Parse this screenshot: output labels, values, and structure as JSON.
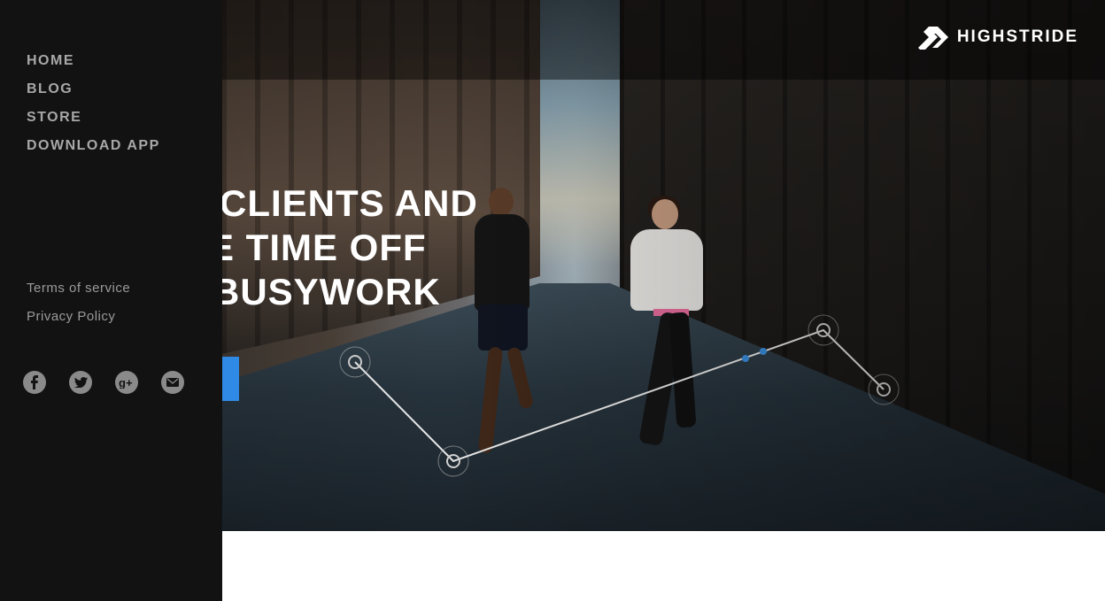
{
  "sidebar": {
    "nav": [
      {
        "label": "HOME"
      },
      {
        "label": "BLOG"
      },
      {
        "label": "STORE"
      },
      {
        "label": "DOWNLOAD APP"
      }
    ],
    "legal": [
      {
        "label": "Terms of service"
      },
      {
        "label": "Privacy Policy"
      }
    ],
    "social": [
      "facebook-icon",
      "twitter-icon",
      "google-plus-icon",
      "email-icon"
    ]
  },
  "header": {
    "logo_text": "HIGHSTRIDE"
  },
  "hero": {
    "headline": [
      "K CLIENTS AND",
      "E TIME OFF",
      " BUSYWORK"
    ],
    "cta_color": "#2f8ae5"
  },
  "colors": {
    "sidebar_bg": "#121212",
    "accent": "#2f8ae5"
  }
}
